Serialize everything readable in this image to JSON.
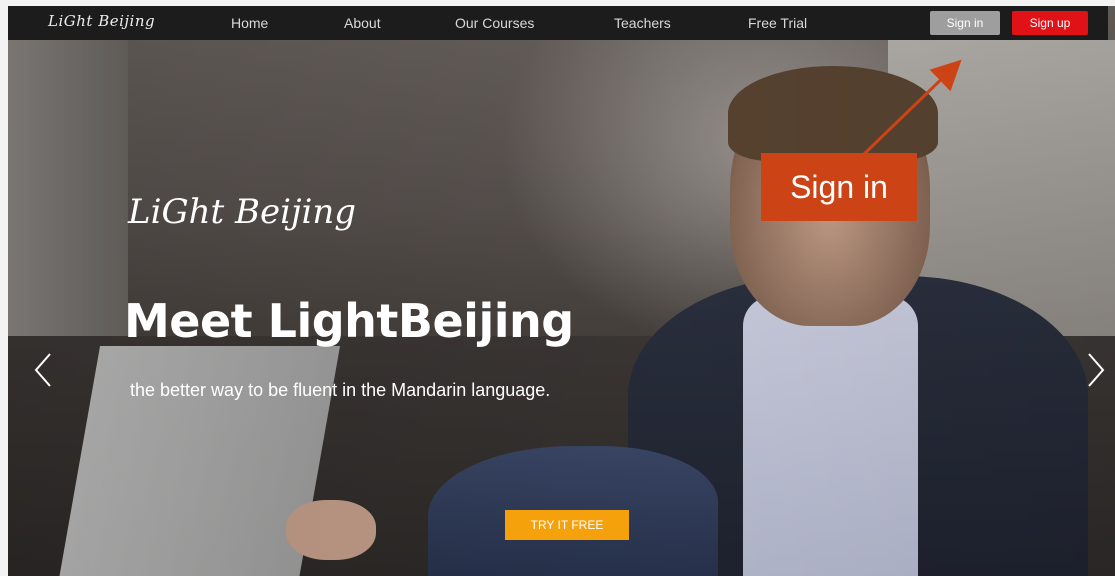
{
  "nav": {
    "logo": "LiGht Beijing",
    "links": [
      "Home",
      "About",
      "Our Courses",
      "Teachers",
      "Free Trial"
    ],
    "signin_label": "Sign in",
    "signup_label": "Sign up"
  },
  "hero": {
    "logo": "LiGht Beijing",
    "title": "Meet LightBeijing",
    "subtitle": "the better way to be fluent in the Mandarin language.",
    "cta_label": "TRY IT FREE"
  },
  "annotation": {
    "label": "Sign in"
  },
  "colors": {
    "navbar": "#1c1c1c",
    "signin": "#9e9e9e",
    "signup": "#e01218",
    "cta": "#f4a10c",
    "callout": "#cc4316"
  },
  "icons": {
    "prev": "chevron-left-icon",
    "next": "chevron-right-icon"
  }
}
